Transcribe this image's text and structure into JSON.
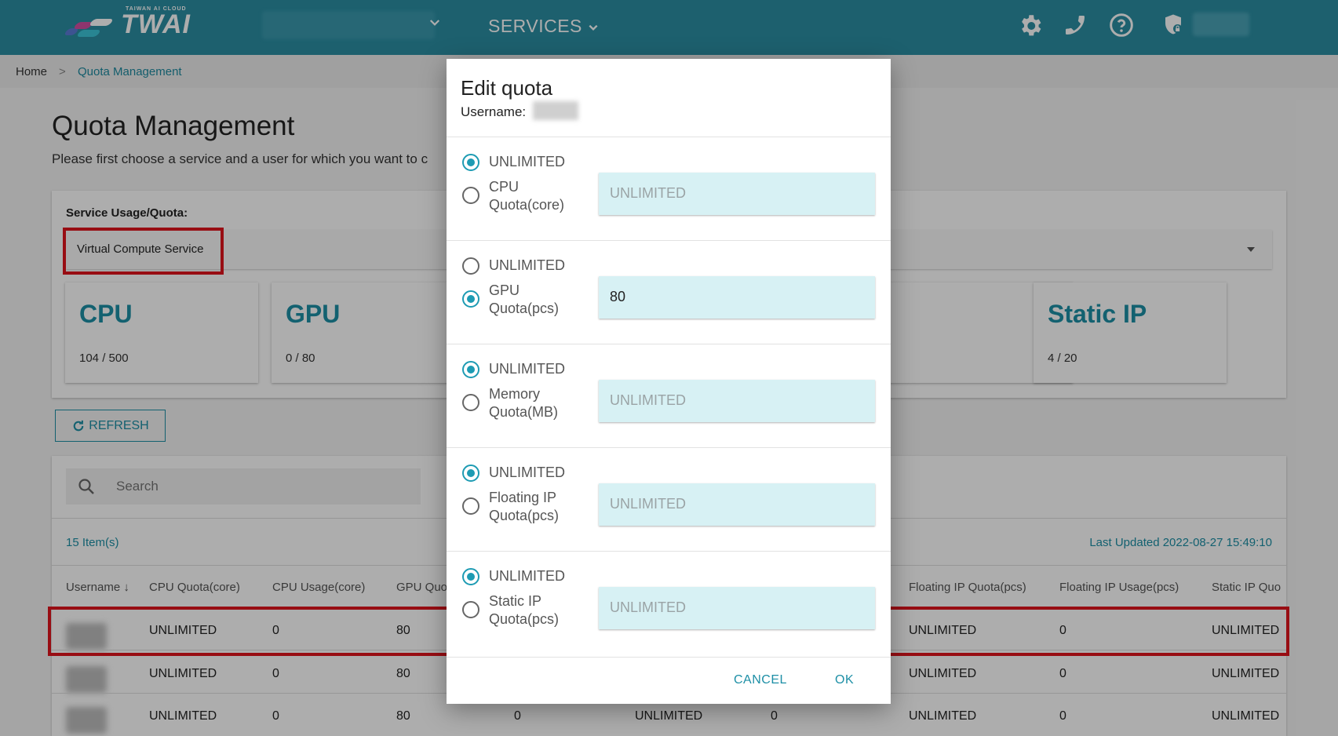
{
  "header": {
    "logo_subtitle": "TAIWAN AI CLOUD",
    "logo_text": "TWAI",
    "services_label": "SERVICES",
    "icons": [
      "gear-icon",
      "phone-icon",
      "help-icon",
      "shield-lock-icon"
    ]
  },
  "breadcrumb": {
    "home": "Home",
    "separator": ">",
    "current": "Quota Management"
  },
  "page": {
    "title": "Quota Management",
    "description": "Please first choose a service and a user for which you want to c"
  },
  "usage": {
    "label": "Service Usage/Quota:",
    "selected_service": "Virtual Compute Service",
    "metrics": [
      {
        "name": "CPU",
        "value": "104 / 500"
      },
      {
        "name": "GPU",
        "value": "0 / 80"
      },
      {
        "name": "Static IP",
        "value": "4 / 20"
      }
    ]
  },
  "refresh_label": "REFRESH",
  "table": {
    "search_placeholder": "Search",
    "item_count": "15 Item(s)",
    "last_updated": "Last Updated 2022-08-27 15:49:10",
    "headers": {
      "username": "Username ↓",
      "cpu_quota": "CPU Quota(core)",
      "cpu_usage": "CPU Usage(core)",
      "gpu_quota": "GPU Quo",
      "fip_quota": "Floating IP Quota(pcs)",
      "fip_usage": "Floating IP Usage(pcs)",
      "sip_quota": "Static IP Quo"
    },
    "rows": [
      {
        "cpu_quota": "UNLIMITED",
        "cpu_usage": "0",
        "gpu_quota": "80",
        "fip_quota": "UNLIMITED",
        "fip_usage": "0",
        "sip_quota": "UNLIMITED"
      },
      {
        "cpu_quota": "UNLIMITED",
        "cpu_usage": "0",
        "gpu_quota": "80",
        "fip_quota": "UNLIMITED",
        "fip_usage": "0",
        "sip_quota": "UNLIMITED"
      },
      {
        "cpu_quota": "UNLIMITED",
        "cpu_usage": "0",
        "gpu_quota": "80",
        "col4": "0",
        "col5": "UNLIMITED",
        "col6": "0",
        "fip_quota": "UNLIMITED",
        "fip_usage": "0",
        "sip_quota": "UNLIMITED"
      }
    ]
  },
  "dialog": {
    "title": "Edit quota",
    "username_label": "Username:",
    "unlimited_label": "UNLIMITED",
    "sections": [
      {
        "label_line1": "CPU",
        "label_line2": "Quota(core)",
        "unlimited_selected": true,
        "value": "UNLIMITED"
      },
      {
        "label_line1": "GPU",
        "label_line2": "Quota(pcs)",
        "unlimited_selected": false,
        "value": "80"
      },
      {
        "label_line1": "Memory",
        "label_line2": "Quota(MB)",
        "unlimited_selected": true,
        "value": "UNLIMITED"
      },
      {
        "label_line1": "Floating IP",
        "label_line2": "Quota(pcs)",
        "unlimited_selected": true,
        "value": "UNLIMITED"
      },
      {
        "label_line1": "Static IP",
        "label_line2": "Quota(pcs)",
        "unlimited_selected": true,
        "value": "UNLIMITED"
      }
    ],
    "cancel_label": "CANCEL",
    "ok_label": "OK"
  },
  "colors": {
    "brand": "#2b8ea3",
    "accent": "#1d8fa6",
    "highlight": "#e0141c"
  }
}
